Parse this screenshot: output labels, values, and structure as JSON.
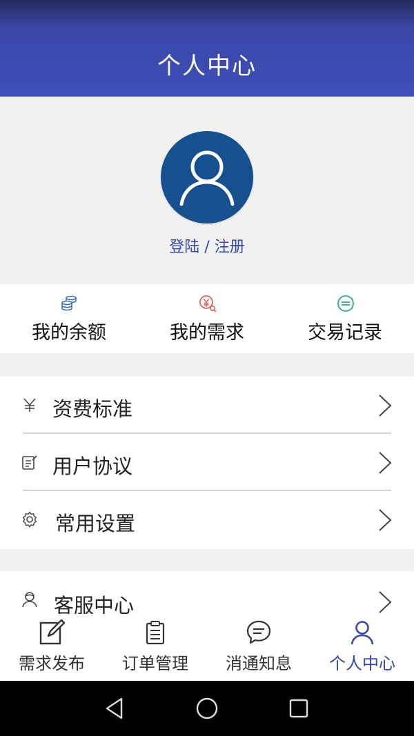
{
  "header": {
    "title": "个人中心"
  },
  "profile": {
    "login_text": "登陆 / 注册",
    "avatar_icon": "user-avatar-icon"
  },
  "quick_actions": [
    {
      "label": "我的余额",
      "icon": "coins-icon",
      "color": "#3a6fb5"
    },
    {
      "label": "我的需求",
      "icon": "yen-search-icon",
      "color": "#d9534f"
    },
    {
      "label": "交易记录",
      "icon": "record-icon",
      "color": "#2bab7e"
    }
  ],
  "menu_group_1": [
    {
      "label": "资费标准",
      "icon": "yen-icon"
    },
    {
      "label": "用户协议",
      "icon": "edit-note-icon"
    },
    {
      "label": "常用设置",
      "icon": "gear-icon"
    }
  ],
  "menu_group_2": [
    {
      "label": "客服中心",
      "icon": "user-service-icon"
    }
  ],
  "tabbar": {
    "tabs": [
      {
        "label": "需求发布",
        "icon": "edit-icon",
        "active": false
      },
      {
        "label": "订单管理",
        "icon": "clipboard-icon",
        "active": false
      },
      {
        "label": "消通知息",
        "icon": "chat-icon",
        "active": false
      },
      {
        "label": "个人中心",
        "icon": "person-icon",
        "active": true
      }
    ]
  },
  "system_nav": {
    "icons": [
      "back-icon",
      "home-icon",
      "recent-apps-icon"
    ]
  },
  "colors": {
    "primary": "#3f4fbb",
    "avatar_bg": "#16508f",
    "link": "#3846a5"
  }
}
